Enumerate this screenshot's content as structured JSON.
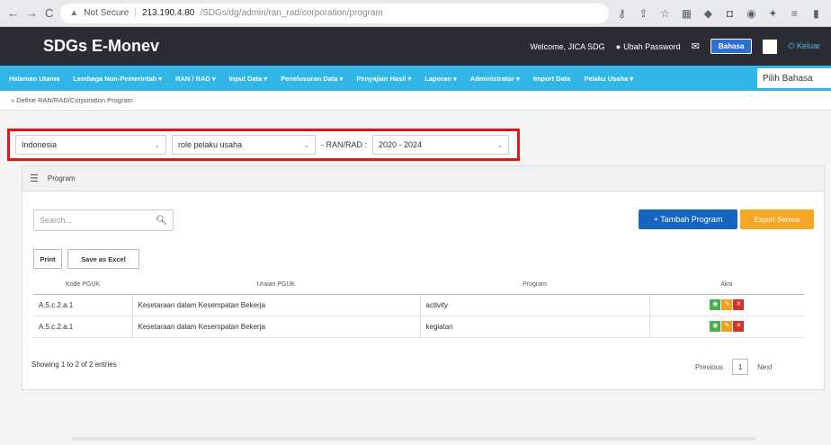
{
  "browser": {
    "security_label": "Not Secure",
    "url_host": "213.190.4.80",
    "url_path": "/SDGs/dg/admin/ran_rad/corporation/program"
  },
  "header": {
    "app_title": "SDGs E-Monev",
    "welcome": "Welcome, JICA SDG",
    "change_password": "Ubah Password",
    "bahasa_label": "Bahasa",
    "logout_label": "Keluar"
  },
  "menu": {
    "items": [
      "Halaman Utama",
      "Lembaga Non-Pemerintah ▾",
      "RAN / RAD ▾",
      "Input Data ▾",
      "Penelusuran Data ▾",
      "Penyajian Hasil ▾",
      "Laporan ▾",
      "Administrator ▾",
      "Import Data",
      "Pelaku Usaha ▾"
    ],
    "language_select": "Pilih Bahasa"
  },
  "breadcrumb": "» Define RAN/RAD/Corporation Program",
  "filters": {
    "region": "Indonesia",
    "actor": "role pelaku usaha",
    "ran_rad_label": "- RAN/RAD :",
    "period": "2020 - 2024"
  },
  "panel": {
    "title": "Program",
    "search_placeholder": "Search...",
    "add_button": "+ Tambah Program",
    "export_button": "Export Semua",
    "print_button": "Print",
    "excel_button": "Save as Excel",
    "columns": [
      "Kode PGUK",
      "Uraian PGUK",
      "Program",
      "Aksi"
    ],
    "rows": [
      {
        "kode": "A.5.c.2.a.1",
        "uraian": "Kesetaraan dalam Kesempatan Bekerja",
        "program": "activity"
      },
      {
        "kode": "A.5.c.2.a.1",
        "uraian": "Kesetaraan dalam Kesempatan Bekerja",
        "program": "kegiatan"
      }
    ],
    "info": "Showing 1 to 2 of 2 entries",
    "pager": {
      "previous": "Previous",
      "page": "1",
      "next": "Next"
    }
  }
}
